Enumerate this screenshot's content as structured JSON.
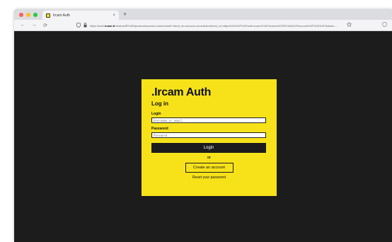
{
  "browser": {
    "tab_title": "Ircam Auth",
    "tab_close": "×",
    "new_tab": "+",
    "url_prefix": "https://auth.",
    "url_host": "ircam.fr",
    "url_rest": "/realms/IRCAM/protocol/openid-connect/auth?client_id=account-console&redirect_uri=https%3A%2F%2Fauth.ircam.fr%2Frealms%2FIRCAM%2Faccount%2F%23%2F&state=…",
    "back_icon": "←",
    "forward_icon": "→",
    "reload_icon": "⟳",
    "traffic_colors": [
      "#ff5f57",
      "#febc2e",
      "#28c840"
    ]
  },
  "login": {
    "brand": ".Ircam Auth",
    "heading": "Log in",
    "login_label": "Login",
    "login_placeholder": "Username or email",
    "password_label": "Password",
    "password_placeholder": "Password",
    "submit_label": "Login",
    "or_label": "or",
    "create_label": "Create an account",
    "reset_label": "Reset your password"
  },
  "colors": {
    "accent": "#f7e21a",
    "background": "#1c1c1c"
  }
}
